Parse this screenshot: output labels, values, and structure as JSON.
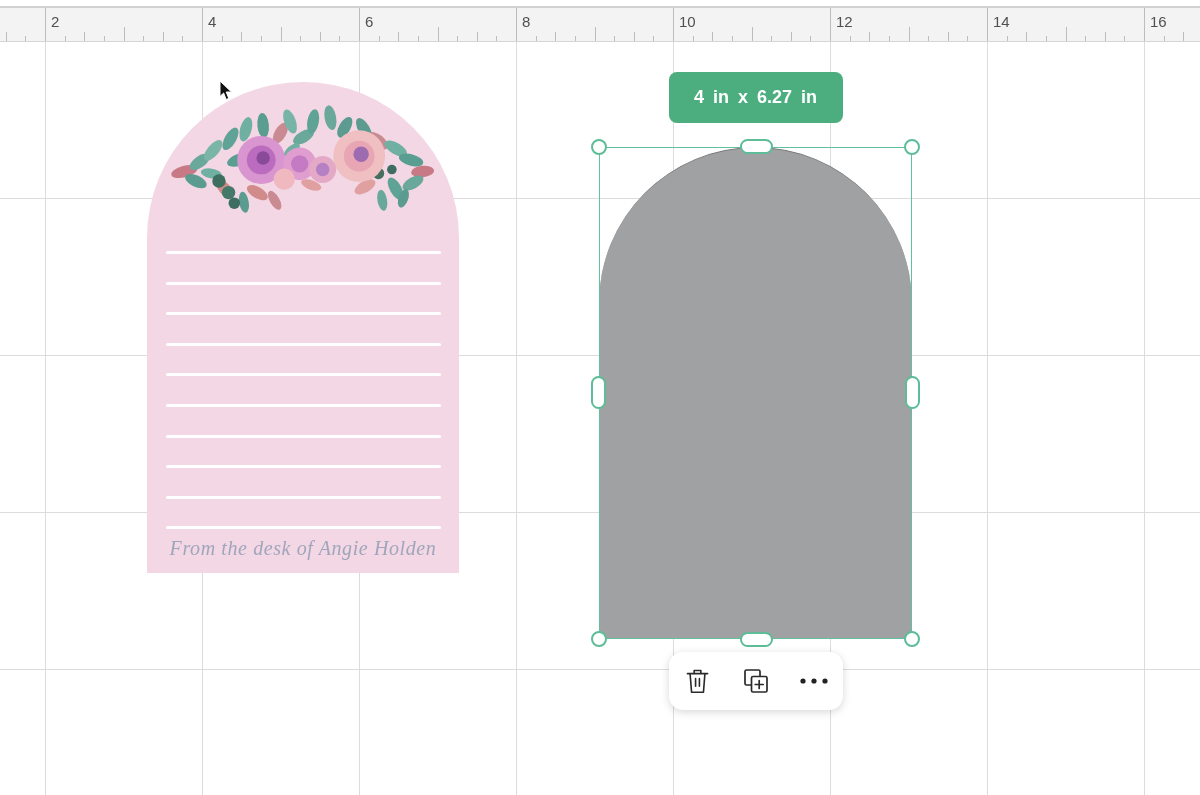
{
  "ruler": {
    "labels": [
      "2",
      "4",
      "6",
      "8",
      "10",
      "12",
      "14",
      "16"
    ]
  },
  "canvas": {
    "objects": [
      {
        "kind": "notepad",
        "selected": false,
        "footer_text": "From the desk of Angie Holden"
      },
      {
        "kind": "arch",
        "selected": true,
        "size_label": "4 in x 6.27 in"
      }
    ],
    "selection_toolbar": {
      "buttons": [
        {
          "kind": "delete"
        },
        {
          "kind": "duplicate"
        },
        {
          "kind": "more"
        }
      ]
    }
  }
}
